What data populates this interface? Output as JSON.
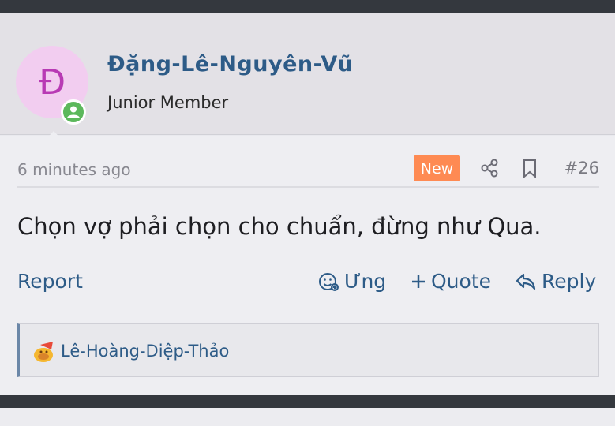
{
  "user": {
    "avatar_letter": "Đ",
    "avatar_bg": "#f2cdf0",
    "avatar_fg": "#b83ab4",
    "online_icon": "user-online-icon",
    "name": "Đặng-Lê-Nguyên-Vũ",
    "title": "Junior Member"
  },
  "post": {
    "timestamp": "6 minutes ago",
    "badge": "New",
    "badge_color": "#fe8a53",
    "share_icon": "share-icon",
    "bookmark_icon": "bookmark-icon",
    "number": "#26",
    "message": "Chọn vợ phải chọn cho chuẩn, đừng như Qua."
  },
  "actions": {
    "report": "Report",
    "react": "Ưng",
    "quote": "Quote",
    "reply": "Reply"
  },
  "reactions": {
    "emoji_icon": "reaction-emoji-icon",
    "users": "Lê-Hoàng-Diệp-Thảo"
  },
  "colors": {
    "link": "#2d5b87",
    "dark_bar": "#34383e"
  }
}
